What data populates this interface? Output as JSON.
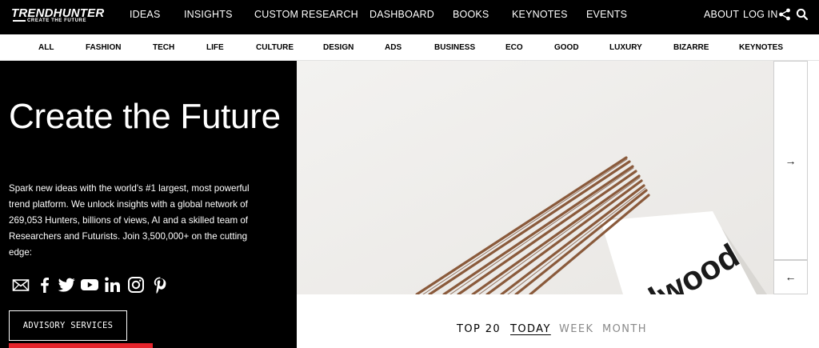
{
  "brand": {
    "name": "TRENDHUNTER",
    "tagline": "CREATE THE FUTURE"
  },
  "top_nav": {
    "items": [
      "IDEAS",
      "INSIGHTS",
      "CUSTOM RESEARCH",
      "DASHBOARD",
      "BOOKS",
      "KEYNOTES",
      "EVENTS"
    ],
    "about": "ABOUT",
    "login": "LOG IN",
    "icons": [
      "share-icon",
      "search-icon"
    ]
  },
  "categories": [
    "ALL",
    "FASHION",
    "TECH",
    "LIFE",
    "CULTURE",
    "DESIGN",
    "ADS",
    "BUSINESS",
    "ECO",
    "GOOD",
    "LUXURY",
    "BIZARRE",
    "KEYNOTES"
  ],
  "hero": {
    "title": "Create the Future",
    "description": "Spark new ideas with the world's #1 largest, most powerful trend platform. We unlock insights with a global network of 269,053 Hunters, billions of views, AI and a skilled team of Researchers and Futurists. Join 3,500,000+ on the cutting edge:",
    "social_icons": [
      "email-icon",
      "facebook-icon",
      "twitter-icon",
      "youtube-icon",
      "linkedin-icon",
      "instagram-icon",
      "pinterest-icon"
    ],
    "advisory_label": "ADVISORY SERVICES"
  },
  "featured_image": {
    "label_text": "dalwood"
  },
  "carousel": {
    "next_icon": "arrow-right-icon",
    "prev_icon": "arrow-left-icon",
    "next_glyph": "→",
    "prev_glyph": "←"
  },
  "top20": {
    "label": "TOP 20",
    "tabs": [
      "TODAY",
      "WEEK",
      "MONTH"
    ],
    "active": "TODAY"
  },
  "colors": {
    "nav_bg": "#000000",
    "accent_red": "#e5242c",
    "inactive_tab": "#8a8a8a"
  }
}
